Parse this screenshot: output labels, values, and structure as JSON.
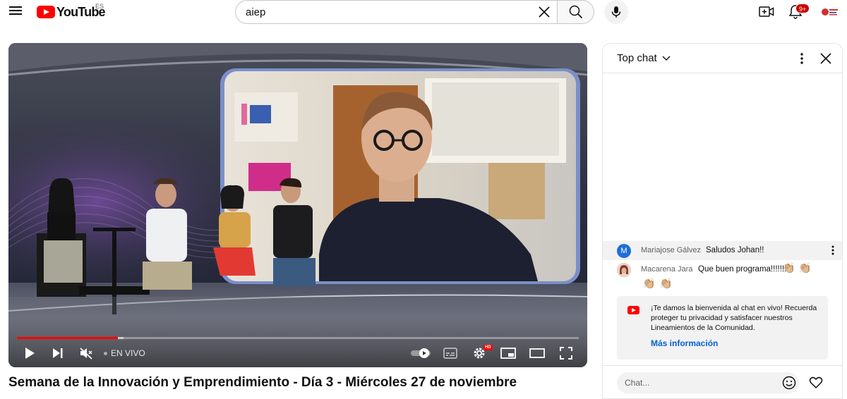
{
  "header": {
    "logo_text": "YouTube",
    "country_code": "ES",
    "search_value": "aiep",
    "notification_count": "9+"
  },
  "player": {
    "live_label": "EN VIVO",
    "hd_badge": "HD",
    "progress_fraction": 0.18,
    "buffer_fraction": 0.19
  },
  "video": {
    "title": "Semana de la Innovación y Emprendimiento - Día 3 - Miércoles 27 de noviembre"
  },
  "chat": {
    "mode_label": "Top chat",
    "messages": [
      {
        "author": "Mariajose Gálvez",
        "text": "Saludos Johan!!",
        "avatar_letter": "M",
        "avatar_color": "#1e6fd9"
      },
      {
        "author": "Macarena Jara",
        "text": "Que buen programa!!!!!!!",
        "emoji": "👏🏼"
      }
    ],
    "welcome_text": "¡Te damos la bienvenida al chat en vivo! Recuerda proteger tu privacidad y satisfacer nuestros Lineamientos de la Comunidad.",
    "welcome_link": "Más información",
    "input_placeholder": "Chat..."
  },
  "colors": {
    "brand_red": "#ff0000",
    "link_blue": "#065fd4"
  },
  "icons": [
    "menu-icon",
    "youtube-logo",
    "clear-icon",
    "search-icon",
    "mic-icon",
    "create-icon",
    "bell-icon",
    "play-icon",
    "next-icon",
    "mute-icon",
    "autoplay-toggle",
    "captions-icon",
    "gear-icon",
    "miniplayer-icon",
    "theater-icon",
    "fullscreen-icon",
    "chevron-down-icon",
    "more-vert-icon",
    "close-icon",
    "emoji-icon",
    "heart-icon"
  ]
}
